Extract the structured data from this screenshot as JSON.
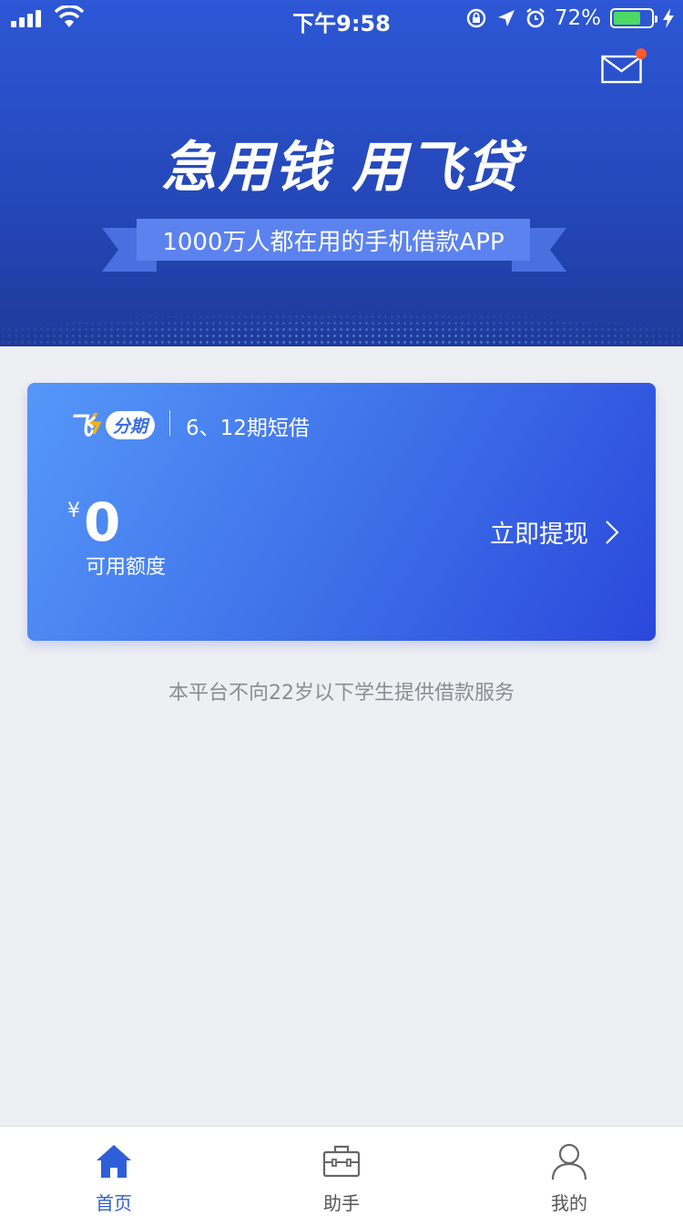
{
  "status_bar": {
    "time": "下午9:58",
    "battery_percent": "72%",
    "battery_level": 0.72
  },
  "header": {
    "slogan": "急用钱 用飞贷",
    "ribbon_text": "1000万人都在用的手机借款APP"
  },
  "card": {
    "logo_pill": "分期",
    "product": "6、12期短借",
    "currency_symbol": "¥",
    "amount": "0",
    "amount_label": "可用额度",
    "withdraw_label": "立即提现"
  },
  "notice": "本平台不向22岁以下学生提供借款服务",
  "tabs": [
    {
      "label": "首页",
      "icon": "home-icon",
      "active": true
    },
    {
      "label": "助手",
      "icon": "toolbox-icon",
      "active": false
    },
    {
      "label": "我的",
      "icon": "user-icon",
      "active": false
    }
  ],
  "colors": {
    "accent": "#2f5fd8",
    "banner": "#2447b8",
    "notification_dot": "#ff5a2c",
    "battery": "#4cd964"
  }
}
